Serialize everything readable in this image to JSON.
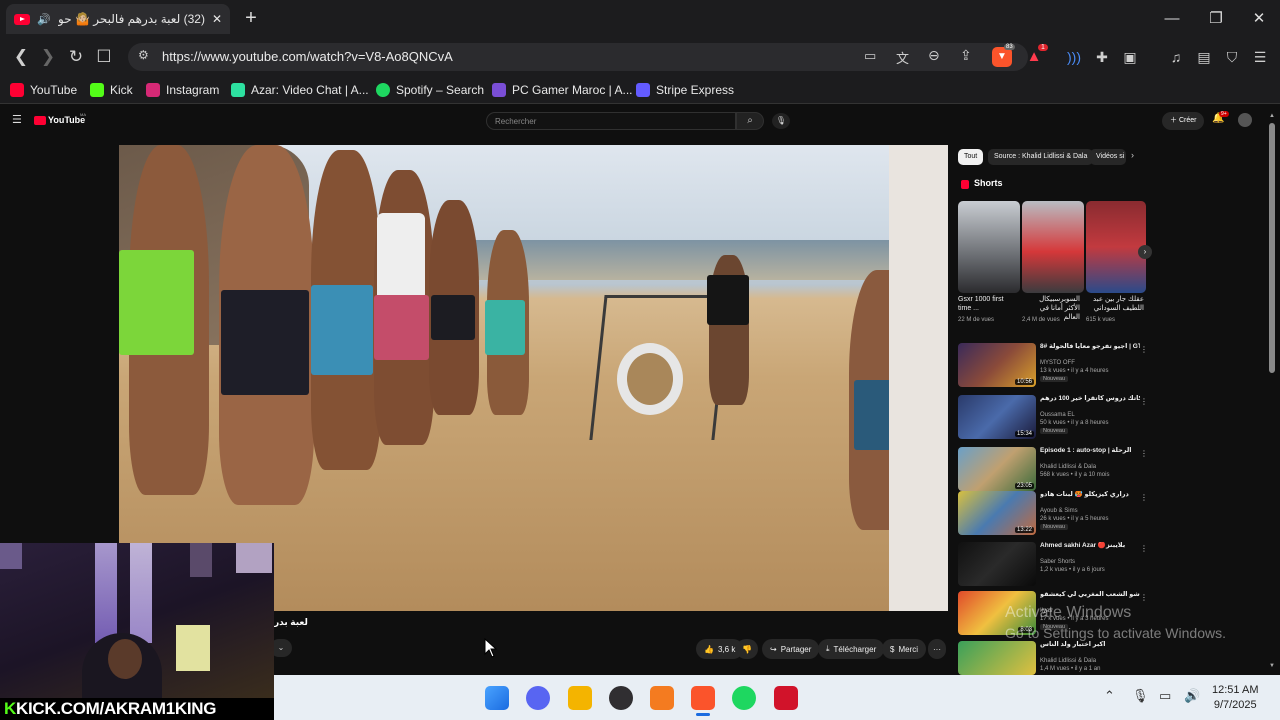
{
  "browser": {
    "tab_title": "(32) لعبة بدرهم فالبحر 🤷🏼 حولة",
    "new_tab": "+",
    "window_controls": {
      "minimize": "—",
      "maximize": "❐",
      "close": "✕"
    },
    "url": "https://www.youtube.com/watch?v=V8-Ao8QNCvA",
    "brave_badge": "83",
    "alert_badge": "1"
  },
  "bookmarks": [
    {
      "label": "YouTube",
      "color": "#ff0033"
    },
    {
      "label": "Kick",
      "color": "#53fc18"
    },
    {
      "label": "Instagram",
      "color": "#d62976"
    },
    {
      "label": "Azar: Video Chat | A...",
      "color": "#2de0a0"
    },
    {
      "label": "Spotify – Search",
      "color": "#1ed760"
    },
    {
      "label": "PC Gamer Maroc | A...",
      "color": "#7a4ed6"
    },
    {
      "label": "Stripe Express",
      "color": "#635bff"
    }
  ],
  "youtube": {
    "logo": "YouTube",
    "logo_suffix": "MA",
    "search_placeholder": "Rechercher",
    "create_label": "Créer",
    "notif_count": "9+",
    "video_title_visible": "لعبة بدر",
    "actions": {
      "likes": "3,6 k",
      "share": "Partager",
      "download": "Télécharger",
      "thanks": "Merci",
      "more": "···"
    },
    "chips": [
      "Tout",
      "Source : Khalid Lidlissi & Dala",
      "Vidéos si"
    ],
    "shorts_label": "Shorts",
    "shorts": [
      {
        "title": "Gsxr 1000 first time ...",
        "views": "22 M de vues"
      },
      {
        "title": "السوبرسبيكال الأكثر أمانا في العالم",
        "views": "2,4 M de vues"
      },
      {
        "title": "عقلك جار بين عبد اللطيف السوداني",
        "views": "615 k vues"
      }
    ],
    "recommended": [
      {
        "title": "أجيو تفرجو معايا فالحولة #8 | GTA RP MAROC #28 |",
        "channel": "MYSTO OFF",
        "meta": "13 k vues • il y a 4 heures",
        "duration": "10:56",
        "badge": "Nouveau"
      },
      {
        "title": "كاتك دروس كاتقرا خير 100 درهم !",
        "channel": "Oussama EL",
        "meta": "50 k vues • il y a 8 heures",
        "duration": "15:34",
        "badge": "Nouveau"
      },
      {
        "title": "Épisode 1 : auto-stop | الرحلة",
        "channel": "Khalid Lidlissi & Dala",
        "meta": "568 k vues • il y a 10 mois",
        "duration": "23:05",
        "badge": ""
      },
      {
        "title": "دراري كيزيكلو 🥵 لبنات هادو",
        "channel": "Ayoub & Sims",
        "meta": "26 k vues • il y a 5 heures",
        "duration": "13:22",
        "badge": "Nouveau"
      },
      {
        "title": "Ahmed sakhi Azar 🔴بلايبنز",
        "channel": "Saber Shorts",
        "meta": "1,2 k vues • il y a 6 jours",
        "duration": "",
        "badge": ""
      },
      {
        "title": "هاشو الشعب المغربي لي كيعشقو",
        "channel": "Ilyas",
        "meta": "17 k vues • il y a 3 heures",
        "duration": "8:03",
        "badge": "Nouveau"
      },
      {
        "title": "أكبر اختبار ولد الناس",
        "channel": "Khalid Lidlissi & Dala",
        "meta": "1,4 M vues • il y a 1 an",
        "duration": "",
        "badge": ""
      }
    ]
  },
  "watermark": {
    "line1": "Activate Windows",
    "line2": "Go to Settings to activate Windows."
  },
  "stream_overlay": {
    "banner": "KICK.COM/AKRAM1KING"
  },
  "taskbar": {
    "time": "12:51 AM",
    "date": "9/7/2025",
    "apps": [
      {
        "name": "windows-start",
        "color": "#1a73e8"
      },
      {
        "name": "discord",
        "color": "#5865f2"
      },
      {
        "name": "file-explorer",
        "color": "#f4b400"
      },
      {
        "name": "obs",
        "color": "#302e31"
      },
      {
        "name": "app-orange",
        "color": "#f47b20"
      },
      {
        "name": "brave",
        "color": "#fb542b"
      },
      {
        "name": "spotify",
        "color": "#1ed760"
      },
      {
        "name": "amd",
        "color": "#d1132a"
      }
    ]
  }
}
